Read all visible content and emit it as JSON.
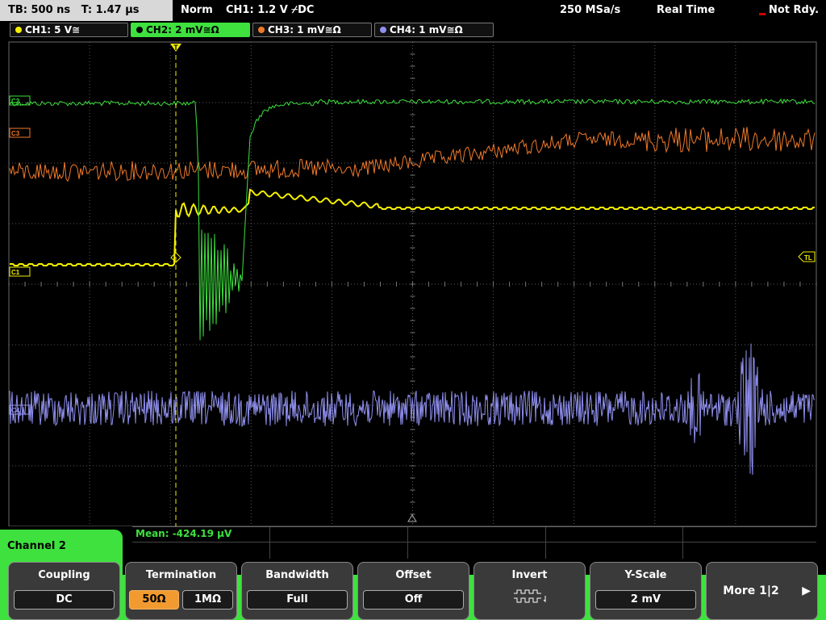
{
  "status_bar": {
    "timebase": "TB: 500 ns",
    "trigger_time": "T: 1.47 µs",
    "trigger_mode": "Norm",
    "trigger_info": "CH1: 1.2 V ⌿DC",
    "sample_rate": "250 MSa/s",
    "acquisition_mode": "Real Time",
    "ready_state": "Not Rdy."
  },
  "channel_tabs": [
    {
      "label": "CH1: 5 V≅",
      "color": "#f5f000"
    },
    {
      "label": "CH2: 2 mV≅Ω",
      "color": "#3ee13e"
    },
    {
      "label": "CH3: 1 mV≅Ω",
      "color": "#f07a2a"
    },
    {
      "label": "CH4: 1 mV≅Ω",
      "color": "#8f8fee"
    }
  ],
  "markers": {
    "ch1": "C1",
    "ch2": "C2",
    "ch3": "C3",
    "ch4": "C4",
    "trigger_level": "TL",
    "trigger_pos": "T"
  },
  "measurement": {
    "text": "Mean: -424.19 µV",
    "color": "#3ee13e"
  },
  "menu": {
    "channel_label": "Channel 2",
    "softkeys": {
      "coupling": {
        "title": "Coupling",
        "value": "DC"
      },
      "termination": {
        "title": "Termination",
        "option_1": "50Ω",
        "option_2": "1MΩ",
        "selected": "50Ω"
      },
      "bandwidth": {
        "title": "Bandwidth",
        "value": "Full"
      },
      "offset": {
        "title": "Offset",
        "value": "Off"
      },
      "invert": {
        "title": "Invert",
        "icon": "invert-waveform-icon"
      },
      "yscale": {
        "title": "Y-Scale",
        "value": "2 mV"
      },
      "more": {
        "label": "More 1|2",
        "icon": "arrow-right-icon"
      }
    }
  },
  "colors": {
    "ch1": "#f5f000",
    "ch2": "#3ee13e",
    "ch3": "#f07a2a",
    "ch4": "#8f8fee",
    "grid": "#5a5a5a",
    "trigger": "#f5f000"
  }
}
